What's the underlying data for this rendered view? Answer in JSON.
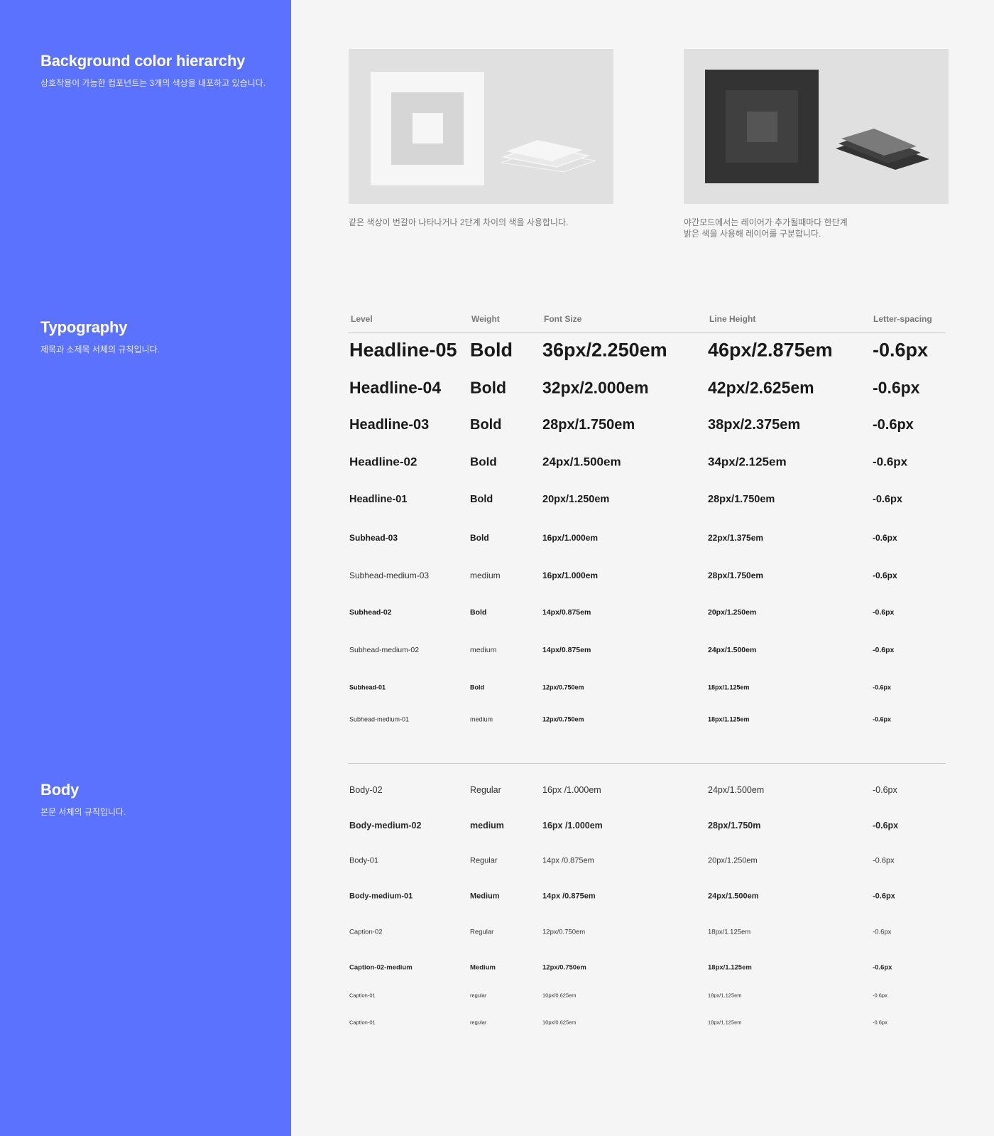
{
  "sidebar": {
    "sections": [
      {
        "title": "Background color hierarchy",
        "desc": "상호작용이 가능한 컴포넌트는 3개의 색상을 내포하고 있습니다."
      },
      {
        "title": "Typography",
        "desc": "제목과 소제목 서체의 규칙입니다."
      },
      {
        "title": "Body",
        "desc": "본문 서체의 규칙입니다."
      }
    ]
  },
  "background": {
    "light_caption": "같은 색상이 번갈아 나타나거나 2단계 차이의 색을 사용합니다.",
    "dark_caption": "야간모드에서는 레이어가 추가될때마다 한단계\n밝은 색을 사용해 레이어를 구분합니다."
  },
  "table": {
    "headers": [
      "Level",
      "Weight",
      "Font Size",
      "Line Height",
      "Letter-spacing"
    ],
    "typography_rows": [
      [
        "Headline-05",
        "Bold",
        "36px/2.250em",
        "46px/2.875em",
        "-0.6px"
      ],
      [
        "Headline-04",
        "Bold",
        "32px/2.000em",
        "42px/2.625em",
        "-0.6px"
      ],
      [
        "Headline-03",
        "Bold",
        "28px/1.750em",
        "38px/2.375em",
        "-0.6px"
      ],
      [
        "Headline-02",
        "Bold",
        "24px/1.500em",
        "34px/2.125em",
        "-0.6px"
      ],
      [
        "Headline-01",
        "Bold",
        "20px/1.250em",
        "28px/1.750em",
        "-0.6px"
      ],
      [
        "Subhead-03",
        "Bold",
        "16px/1.000em",
        "22px/1.375em",
        "-0.6px"
      ],
      [
        "Subhead-medium-03",
        "medium",
        "16px/1.000em",
        "28px/1.750em",
        "-0.6px"
      ],
      [
        "Subhead-02",
        "Bold",
        "14px/0.875em",
        "20px/1.250em",
        "-0.6px"
      ],
      [
        "Subhead-medium-02",
        "medium",
        "14px/0.875em",
        "24px/1.500em",
        "-0.6px"
      ],
      [
        "Subhead-01",
        "Bold",
        "12px/0.750em",
        "18px/1.125em",
        "-0.6px"
      ],
      [
        "Subhead-medium-01",
        "medium",
        "12px/0.750em",
        "18px/1.125em",
        "-0.6px"
      ]
    ],
    "body_rows": [
      [
        "Body-02",
        "Regular",
        "16px /1.000em",
        "24px/1.500em",
        "-0.6px"
      ],
      [
        "Body-medium-02",
        "medium",
        "16px /1.000em",
        "28px/1.750m",
        "-0.6px"
      ],
      [
        "Body-01",
        "Regular",
        "14px /0.875em",
        "20px/1.250em",
        "-0.6px"
      ],
      [
        "Body-medium-01",
        "Medium",
        "14px /0.875em",
        "24px/1.500em",
        "-0.6px"
      ],
      [
        "Caption-02",
        "Regular",
        "12px/0.750em",
        "18px/1.125em",
        "-0.6px"
      ],
      [
        "Caption-02-medium",
        "Medium",
        "12px/0.750em",
        "18px/1.125em",
        "-0.6px"
      ],
      [
        "Caption-01",
        "regular",
        "10px/0.625em",
        "18px/1.125em",
        "-0.6px"
      ],
      [
        "Caption-01",
        "regular",
        "10px/0.625em",
        "18px/1.125em",
        "-0.6px"
      ]
    ]
  },
  "colors": {
    "sidebar": "#5b72fe",
    "page": "#f5f5f5",
    "light_layers": [
      "#f6f6f6",
      "#d6d6d6",
      "#f6f6f6"
    ],
    "dark_layers": [
      "#333333",
      "#404040",
      "#555555"
    ]
  }
}
